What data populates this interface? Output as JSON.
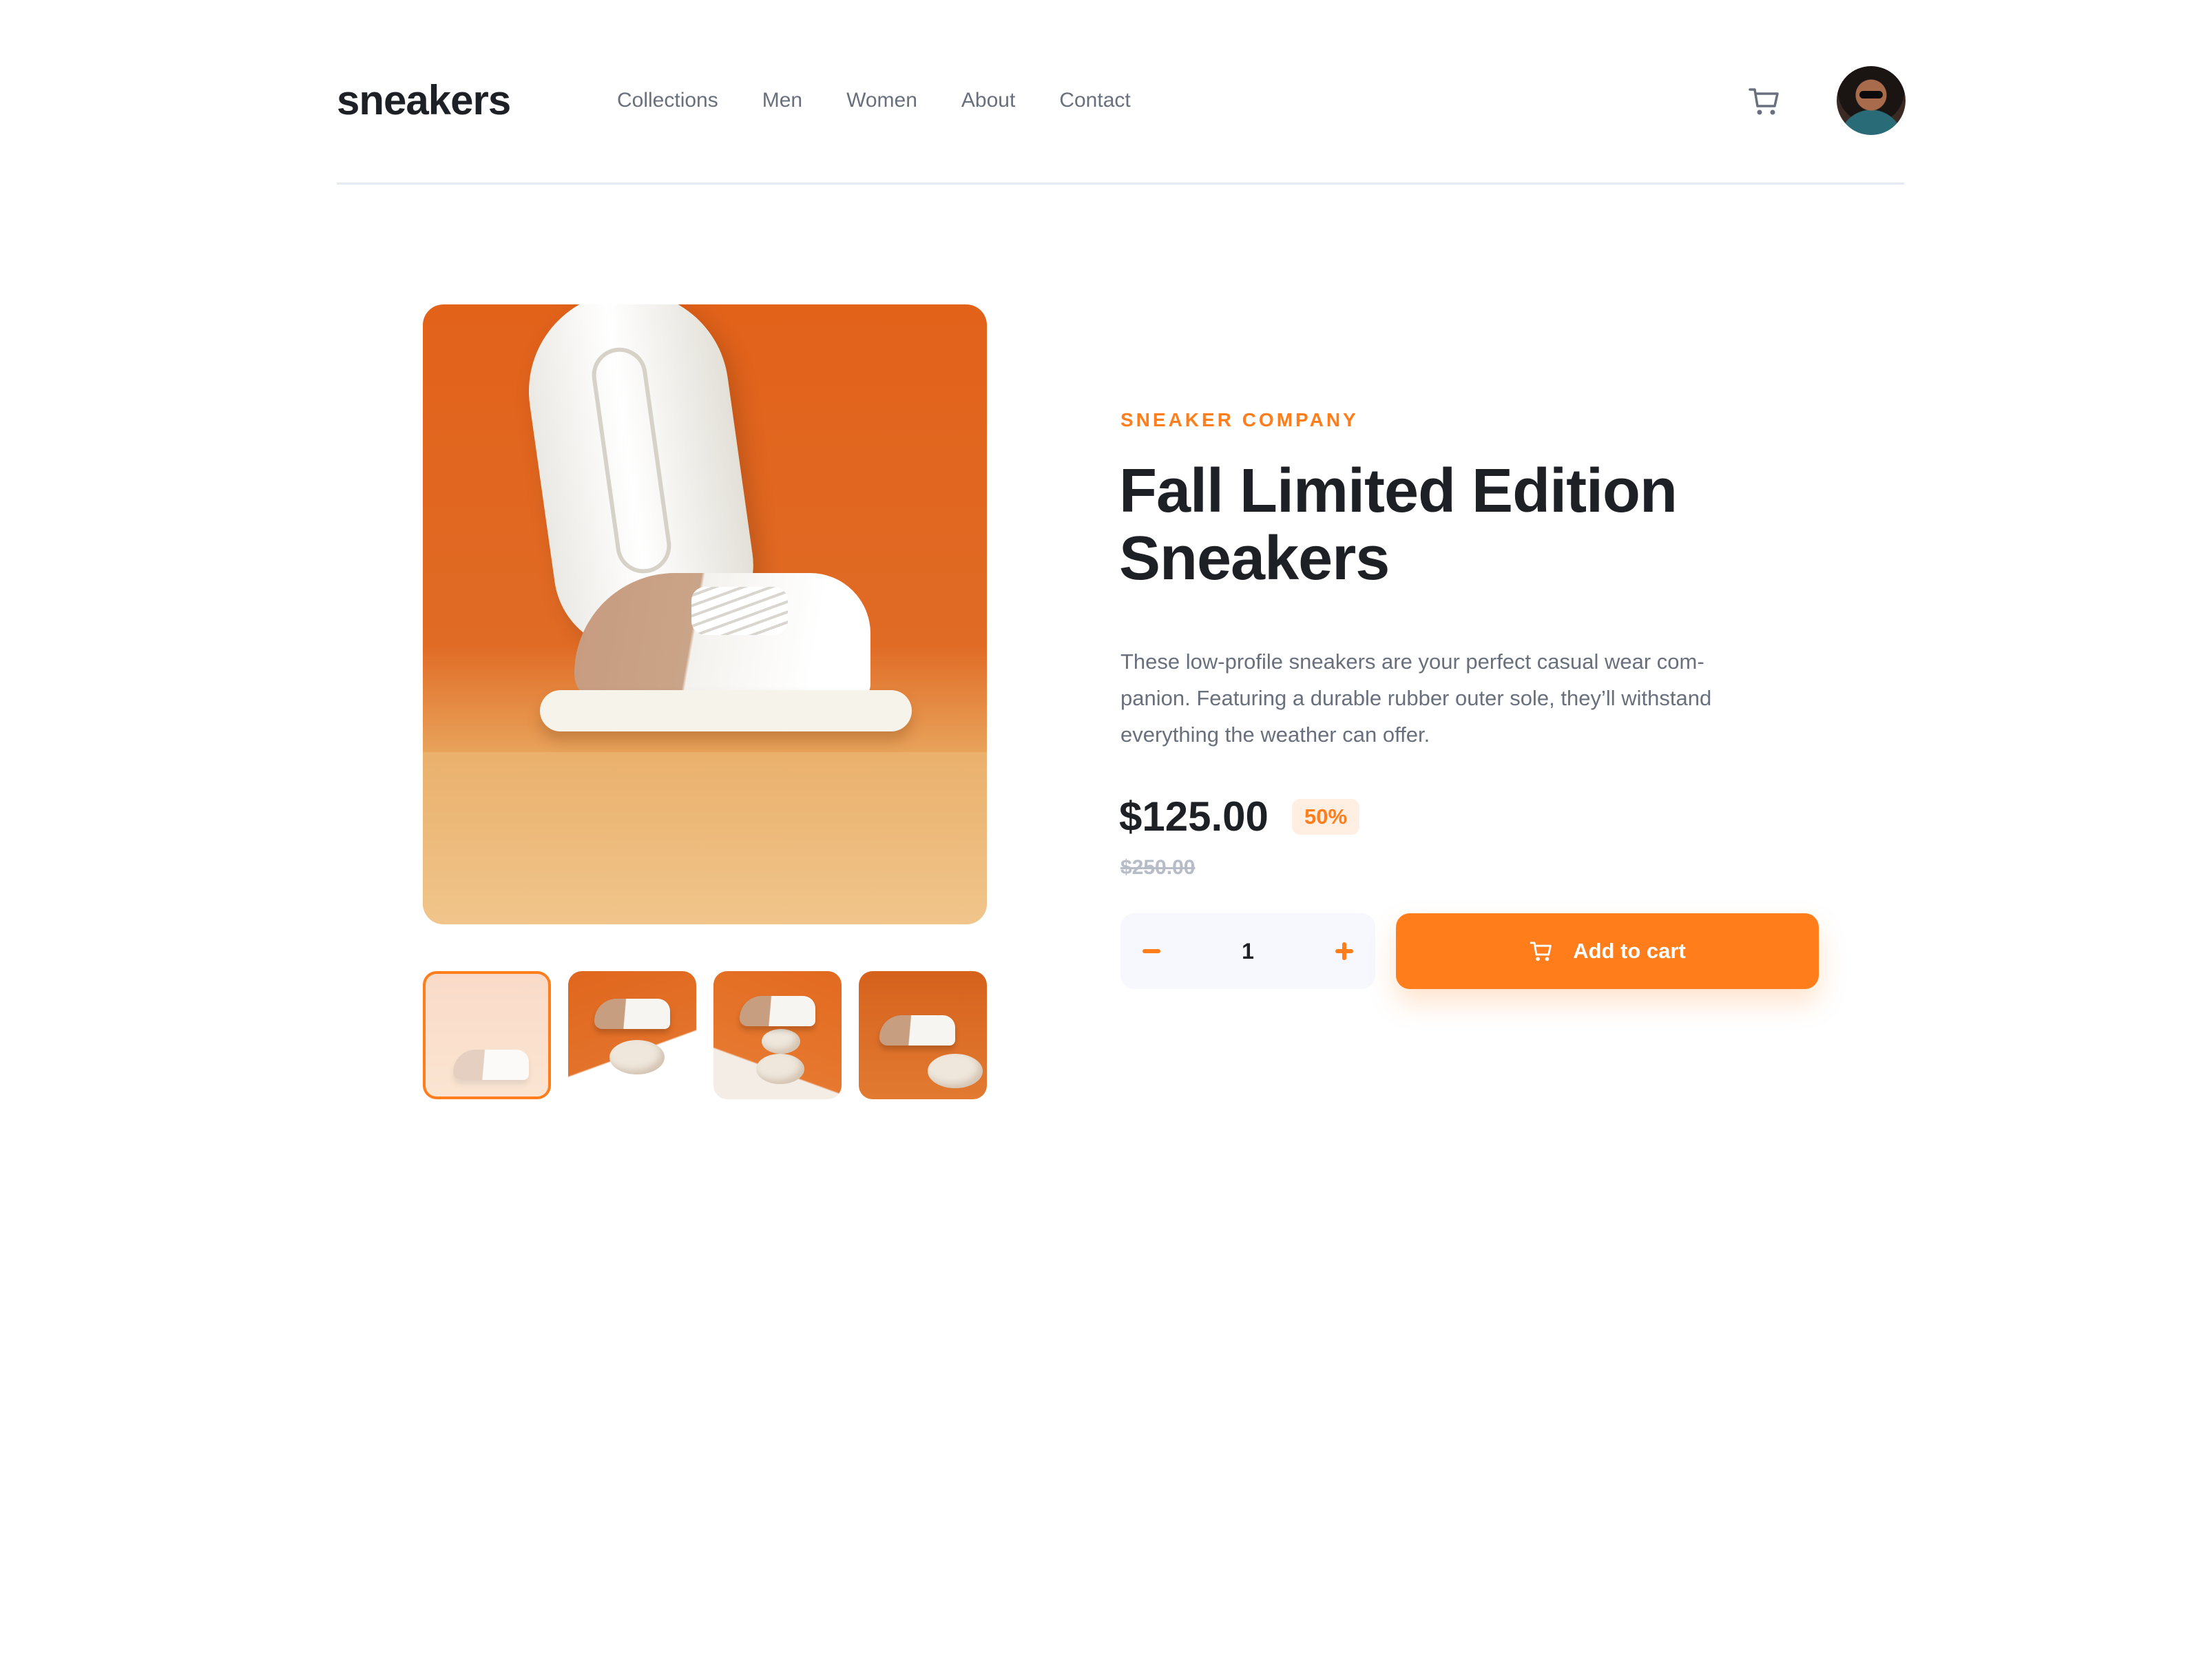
{
  "brand": {
    "logo_text": "sneakers"
  },
  "nav": {
    "items": [
      {
        "label": "Collections"
      },
      {
        "label": "Men"
      },
      {
        "label": "Women"
      },
      {
        "label": "About"
      },
      {
        "label": "Contact"
      }
    ]
  },
  "header": {
    "cart_icon": "cart-icon",
    "avatar": "user-avatar"
  },
  "gallery": {
    "main_image": "sneaker-product-photo",
    "thumbnails": [
      {
        "name": "thumbnail-1",
        "selected": true
      },
      {
        "name": "thumbnail-2",
        "selected": false
      },
      {
        "name": "thumbnail-3",
        "selected": false
      },
      {
        "name": "thumbnail-4",
        "selected": false
      }
    ]
  },
  "product": {
    "company": "SNEAKER COMPANY",
    "title_line1": "Fall Limited Edition",
    "title_line2": "Sneakers",
    "description_line1": "These low-profile sneakers are your perfect casual wear com-",
    "description_line2": "panion. Featuring a durable rubber outer sole, they’ll withstand",
    "description_line3": "everything the weather can offer.",
    "price": "$125.00",
    "discount": "50%",
    "original_price": "$250.00"
  },
  "cart_controls": {
    "quantity": "1",
    "minus_icon": "minus-icon",
    "plus_icon": "plus-icon",
    "add_to_cart_label": "Add to cart"
  },
  "colors": {
    "accent": "#ff7e1b",
    "accent_pale": "#ffeee2",
    "text_dark": "#1d2025",
    "text_grey": "#69707d",
    "text_light": "#b6bcc8",
    "stepper_bg": "#f6f8fd"
  }
}
